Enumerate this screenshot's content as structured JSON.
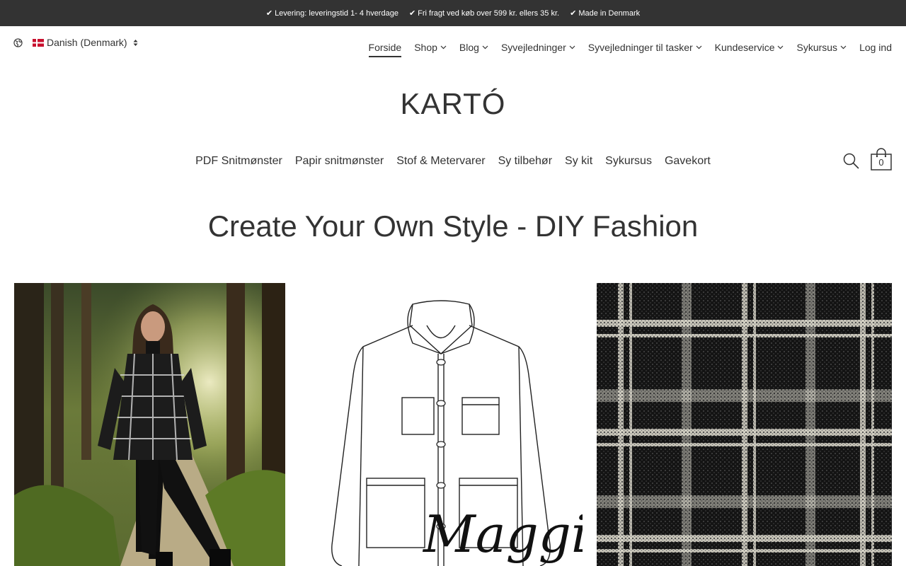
{
  "topbar": {
    "usps": [
      "Levering: leveringstid 1- 4 hverdage",
      "Fri fragt ved køb over 599 kr. ellers 35 kr.",
      "Made in Denmark"
    ],
    "check_glyph": "✔"
  },
  "language": {
    "selected": "Danish (Denmark)",
    "icon": "globe-icon"
  },
  "mainnav": {
    "items": [
      {
        "label": "Forside"
      },
      {
        "label": "Shop"
      },
      {
        "label": "Blog"
      },
      {
        "label": "Syvejledninger"
      },
      {
        "label": "Syvejledninger til tasker"
      },
      {
        "label": "Kundeservice"
      },
      {
        "label": "Sykursus"
      },
      {
        "label": "Log ind"
      }
    ]
  },
  "brand": {
    "name": "KARTÓ"
  },
  "catnav": {
    "items": [
      "PDF Snitmønster",
      "Papir snitmønster",
      "Stof & Metervarer",
      "Sy tilbehør",
      "Sy kit",
      "Sykursus",
      "Gavekort"
    ]
  },
  "cart": {
    "count": "0"
  },
  "hero": {
    "headline": "Create Your Own Style - DIY Fashion"
  },
  "tiles": {
    "tile2_signature": "Maggi"
  },
  "colors": {
    "topbar_bg": "#333333",
    "text": "#333333",
    "background": "#ffffff"
  }
}
